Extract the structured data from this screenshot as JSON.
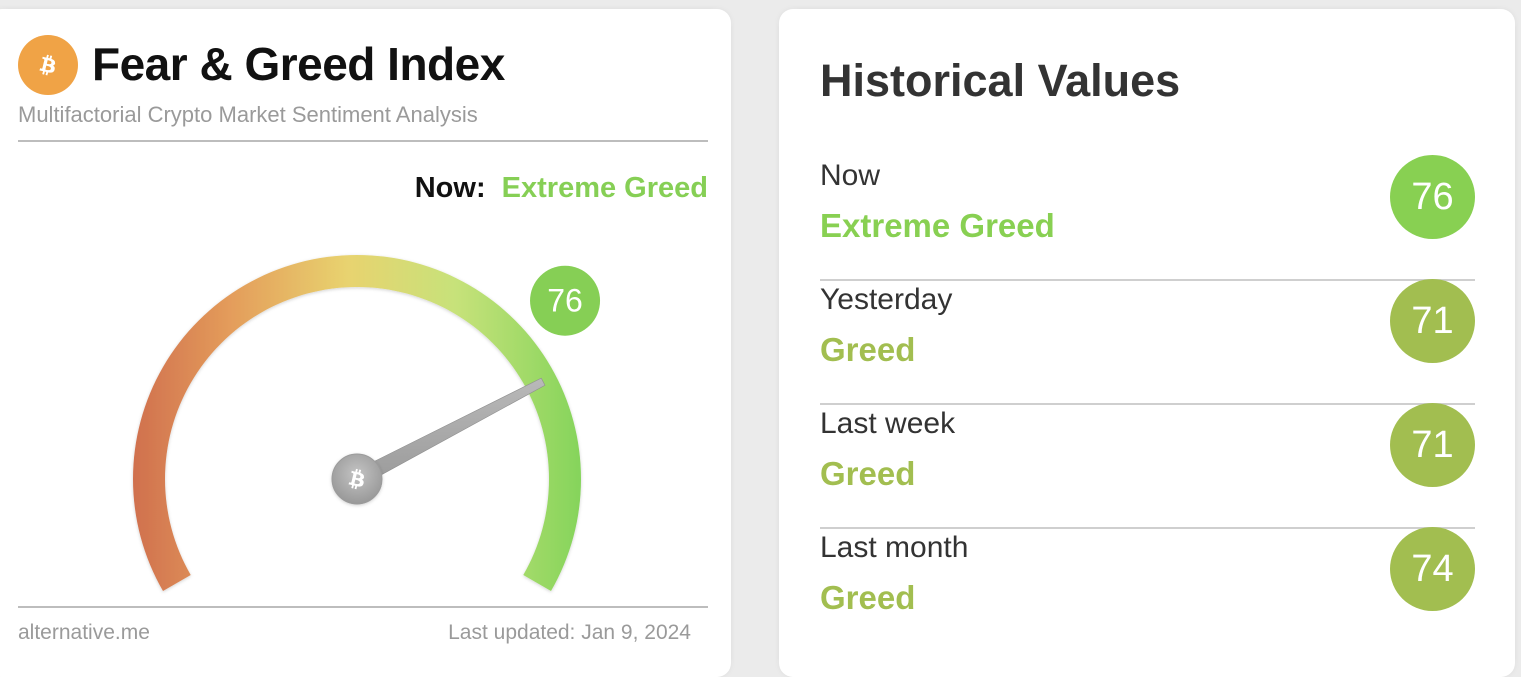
{
  "left_card": {
    "title": "Fear & Greed Index",
    "subtitle": "Multifactorial Crypto Market Sentiment Analysis",
    "logo_icon": "bitcoin-icon",
    "now_label": "Now:",
    "now_classification": "Extreme Greed",
    "gauge": {
      "value": 76,
      "min": 0,
      "max": 100,
      "value_label": "76",
      "pivot_icon": "bitcoin-icon",
      "badge_color": "#86cf55",
      "gradient_colors": [
        "#d26f4d",
        "#e9a85a",
        "#e8d870",
        "#c9e27a",
        "#86d45a"
      ]
    },
    "footer_source": "alternative.me",
    "footer_updated": "Last updated: Jan 9, 2024"
  },
  "right_card": {
    "title": "Historical Values",
    "rows": [
      {
        "label": "Now",
        "classification": "Extreme Greed",
        "value": "76",
        "color": "#88d052"
      },
      {
        "label": "Yesterday",
        "classification": "Greed",
        "value": "71",
        "color": "#a2be50"
      },
      {
        "label": "Last week",
        "classification": "Greed",
        "value": "71",
        "color": "#a2be50"
      },
      {
        "label": "Last month",
        "classification": "Greed",
        "value": "74",
        "color": "#a2be50"
      }
    ]
  },
  "colors": {
    "bitcoin_orange": "#f0a346",
    "extreme_greed": "#86cf55",
    "greed": "#a2be50",
    "background": "#ebebeb"
  }
}
